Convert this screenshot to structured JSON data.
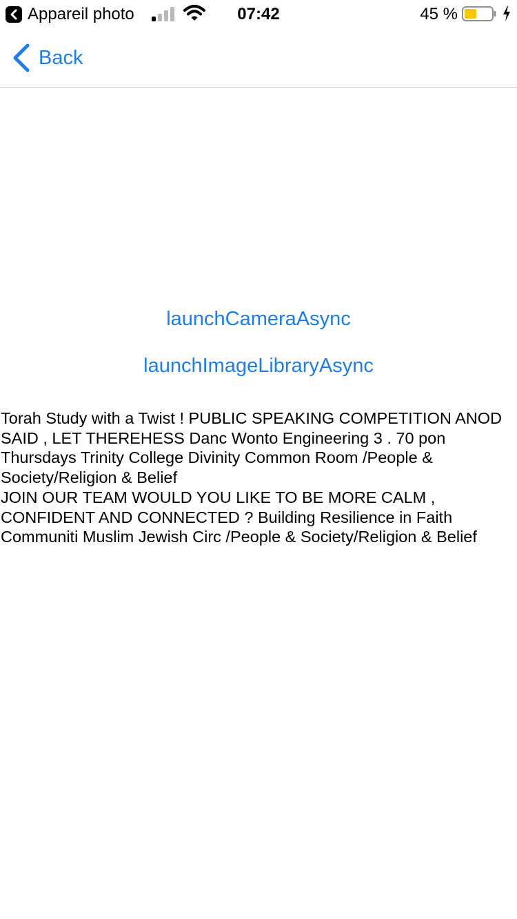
{
  "status_bar": {
    "back_app_label": "Appareil photo",
    "time": "07:42",
    "battery_percent": "45 %",
    "battery_level": 0.45,
    "signal_bars_active": 1,
    "icons": {
      "back_app": "chevron-left-icon",
      "signal": "cellular-signal-icon",
      "wifi": "wifi-icon",
      "battery": "battery-icon",
      "charging": "lightning-bolt-icon"
    }
  },
  "nav": {
    "back_label": "Back",
    "back_icon": "chevron-left-icon"
  },
  "actions": {
    "camera_label": "launchCameraAsync",
    "library_label": "launchImageLibraryAsync"
  },
  "result": {
    "text": "Torah Study with a Twist ! PUBLIC SPEAKING COMPETITION ANOD SAID , LET THEREHESS Danc Wonto Engineering 3 . 70 pon Thursdays Trinity College Divinity Common Room /People & Society/Religion & Belief\nJOIN OUR TEAM WOULD YOU LIKE TO BE MORE CALM , CONFIDENT AND CONNECTED ? Building Resilience in Faith Communiti Muslim Jewish Circ /People & Society/Religion & Belief"
  },
  "colors": {
    "accent": "#1a7ef0",
    "battery_fill": "#f7c604",
    "divider": "#c8c8cc"
  }
}
